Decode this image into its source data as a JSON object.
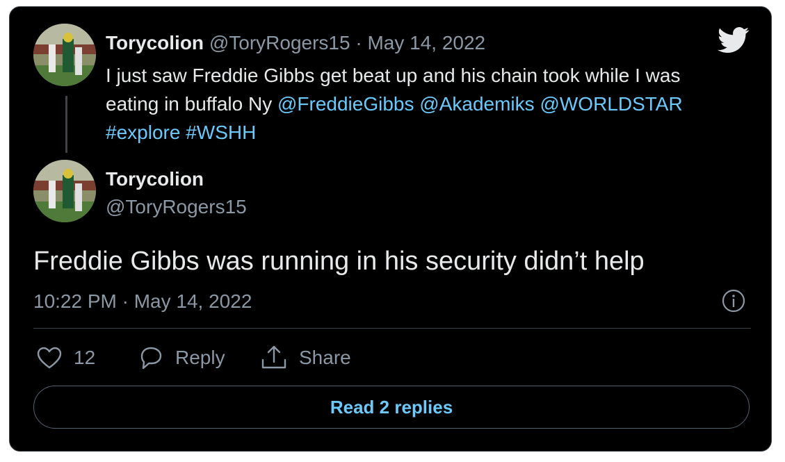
{
  "parent_tweet": {
    "author_name": "Torycolion",
    "author_handle": "@ToryRogers15",
    "separator": "·",
    "date": "May 14, 2022",
    "text_plain": "I just saw Freddie Gibbs get beat up and his chain took while I was eating in buffalo Ny ",
    "mentions": [
      "@FreddieGibbs",
      "@Akademiks",
      "@WORLDSTAR"
    ],
    "hashtags": [
      "#explore",
      "#WSHH"
    ]
  },
  "reply_tweet": {
    "author_name": "Torycolion",
    "author_handle": "@ToryRogers15",
    "text": "Freddie Gibbs was running in his security didn’t help",
    "timestamp": "10:22 PM · May 14, 2022"
  },
  "actions": {
    "like_count": "12",
    "reply_label": "Reply",
    "share_label": "Share"
  },
  "read_replies_label": "Read 2 replies",
  "icons": {
    "brand": "twitter-bird-icon",
    "info": "info-icon",
    "like": "heart-icon",
    "reply": "speech-bubble-icon",
    "share": "share-upload-icon"
  },
  "colors": {
    "background": "#000000",
    "text": "#e7e9ea",
    "secondary_text": "#8b98a5",
    "link": "#6bc9fb",
    "border": "#3d4348"
  }
}
